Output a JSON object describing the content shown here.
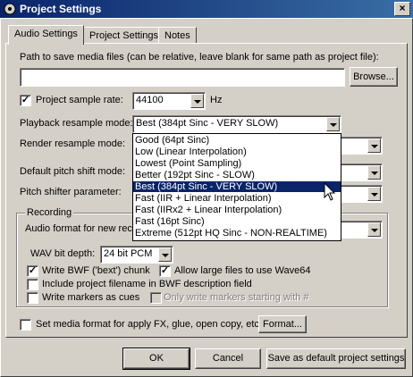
{
  "window": {
    "title": "Project Settings",
    "close_glyph": "×"
  },
  "tabs": [
    {
      "label": "Audio Settings",
      "active": true
    },
    {
      "label": "Project Settings",
      "active": false
    },
    {
      "label": "Notes",
      "active": false
    }
  ],
  "media_path": {
    "label": "Path to save media files (can be relative, leave blank for same path as project file):",
    "value": "",
    "browse_label": "Browse..."
  },
  "sample_rate": {
    "checked": true,
    "label": "Project sample rate:",
    "value": "44100",
    "unit": "Hz"
  },
  "playback_resample": {
    "label": "Playback resample mode:",
    "value": "Best (384pt Sinc - VERY SLOW)"
  },
  "render_resample": {
    "label": "Render resample mode:"
  },
  "pitch_shift_mode": {
    "label": "Default pitch shift mode:"
  },
  "pitch_shifter_param": {
    "label": "Pitch shifter parameter:"
  },
  "resample_options": [
    "Good (64pt Sinc)",
    "Low (Linear Interpolation)",
    "Lowest (Point Sampling)",
    "Better (192pt Sinc - SLOW)",
    "Best (384pt Sinc - VERY SLOW)",
    "Fast (IIR + Linear Interpolation)",
    "Fast (IIRx2 + Linear Interpolation)",
    "Fast (16pt Sinc)",
    "Extreme (512pt HQ Sinc - NON-REALTIME)"
  ],
  "highlighted_option_index": 4,
  "recording": {
    "group_label": "Recording",
    "audio_format_label": "Audio format for new reco",
    "wav_bit_depth_label": "WAV bit depth:",
    "wav_bit_depth_value": "24 bit PCM",
    "write_bwf": {
      "checked": true,
      "label": "Write BWF ('bext') chunk"
    },
    "allow_large": {
      "checked": true,
      "label": "Allow large files to use Wave64"
    },
    "include_filename": {
      "checked": false,
      "label": "Include project filename in BWF description field"
    },
    "write_markers": {
      "checked": false,
      "label": "Write markers as cues"
    },
    "only_markers": {
      "checked": false,
      "label": "Only write markers starting with #"
    }
  },
  "media_format": {
    "checked": false,
    "label": "Set media format for apply FX, glue, open copy, etc:",
    "button_label": "Format..."
  },
  "footer": {
    "ok": "OK",
    "cancel": "Cancel",
    "save_default": "Save as default project settings"
  },
  "check_glyph": "✓",
  "colors": {
    "titlebar_start": "#0a246a",
    "titlebar_end": "#3a6ea5",
    "face": "#d4d0c8",
    "highlight": "#0a246a"
  }
}
